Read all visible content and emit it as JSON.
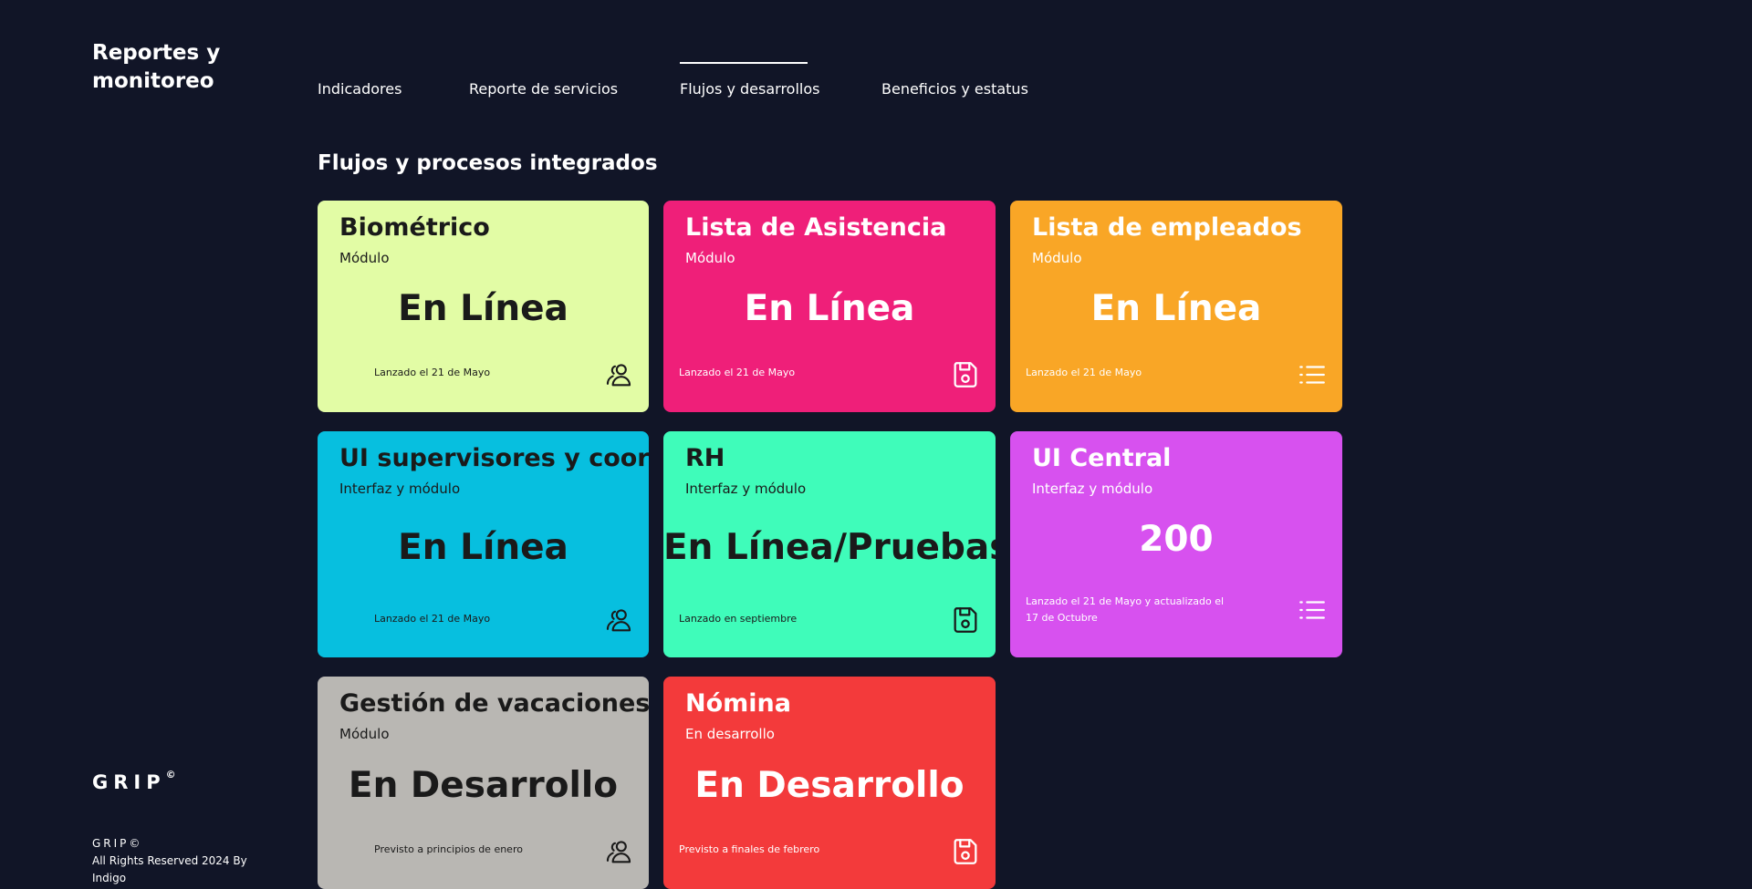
{
  "brand": {
    "title": "Reportes y monitoreo"
  },
  "nav": {
    "items": [
      {
        "label": "Indicadores"
      },
      {
        "label": "Reporte de servicios"
      },
      {
        "label": "Flujos y desarrollos"
      },
      {
        "label": "Beneficios y estatus"
      }
    ]
  },
  "section": {
    "title": "Flujos y procesos integrados"
  },
  "cards": [
    {
      "title": "Biométrico",
      "subtitle": "Módulo",
      "status": "En Línea",
      "footer": "Lanzado el 21 de Mayo",
      "icon": "users-icon",
      "bg": "#e2fca5"
    },
    {
      "title": "Lista de Asistencia",
      "subtitle": "Módulo",
      "status": "En Línea",
      "footer": "Lanzado el 21 de Mayo",
      "icon": "save-icon",
      "bg": "#ef1f79"
    },
    {
      "title": "Lista de empleados",
      "subtitle": "Módulo",
      "status": "En Línea",
      "footer": "Lanzado el 21 de Mayo",
      "icon": "list-icon",
      "bg": "#f9a626"
    },
    {
      "title": "UI supervisores y coord",
      "subtitle": "Interfaz y módulo",
      "status": "En Línea",
      "footer": "Lanzado el 21 de Mayo",
      "icon": "users-icon",
      "bg": "#07bfdf"
    },
    {
      "title": "RH",
      "subtitle": "Interfaz y módulo",
      "status": "En Línea/Pruebas",
      "footer": "Lanzado en septiembre",
      "icon": "save-icon",
      "bg": "#3ffcba"
    },
    {
      "title": "UI Central",
      "subtitle": "Interfaz y módulo",
      "status": "200",
      "footer": "Lanzado el 21 de Mayo y actualizado el 17 de Octubre",
      "icon": "list-icon",
      "bg": "#d751ef"
    },
    {
      "title": "Gestión de vacaciones",
      "subtitle": "Módulo",
      "status": "En Desarrollo",
      "footer": "Previsto a principios de enero",
      "icon": "users-icon",
      "bg": "#b9b7b3"
    },
    {
      "title": "Nómina",
      "subtitle": "En desarrollo",
      "status": "En Desarrollo",
      "footer": "Previsto a finales de febrero",
      "icon": "save-icon",
      "bg": "#f33a3b"
    }
  ],
  "footer": {
    "logo": "GRIP",
    "logo_mark": "©",
    "copyright_mark": "GRIP©",
    "copyright_line": "All Rights Reserved 2024 By Indigo"
  }
}
